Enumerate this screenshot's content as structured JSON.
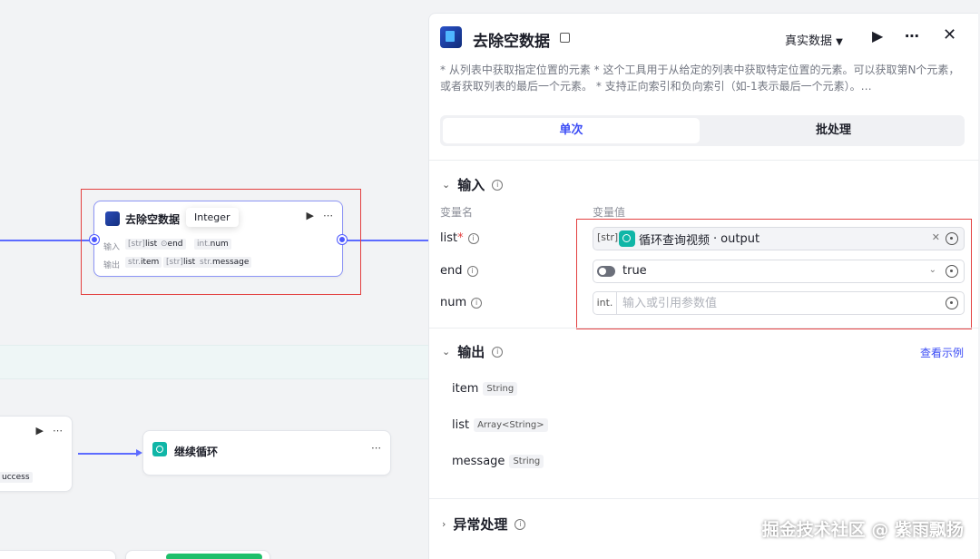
{
  "canvas": {
    "selected_node": {
      "title": "去除空数据",
      "tooltip": "Integer",
      "input_label": "输入",
      "output_label": "输出",
      "inputs": [
        {
          "type": "[str]",
          "name": "list"
        },
        {
          "type": "⊙",
          "name": "end"
        },
        {
          "type": "int.",
          "name": "num"
        }
      ],
      "outputs": [
        {
          "type": "str.",
          "name": "item"
        },
        {
          "type": "[str]",
          "name": "list"
        },
        {
          "type": "str.",
          "name": "message"
        }
      ]
    },
    "continue_node": {
      "title": "继续循环"
    },
    "partial_node": {
      "output_text": "uccess"
    }
  },
  "panel": {
    "title": "去除空数据",
    "mode": "真实数据",
    "description": "* 从列表中获取指定位置的元素 * 这个工具用于从给定的列表中获取特定位置的元素。可以获取第N个元素，或者获取列表的最后一个元素。 * 支持正向索引和负向索引（如-1表示最后一个元素）。…",
    "tabs": {
      "single": "单次",
      "batch": "批处理"
    },
    "input_section": {
      "title": "输入",
      "col_name": "变量名",
      "col_value": "变量值",
      "rows": [
        {
          "name": "list",
          "required": "*",
          "type": "[str]",
          "ref_node": "循环查询视频",
          "ref_sep": " · ",
          "ref_field": "output"
        },
        {
          "name": "end",
          "value": "true"
        },
        {
          "name": "num",
          "type": "int.",
          "placeholder": "输入或引用参数值"
        }
      ]
    },
    "output_section": {
      "title": "输出",
      "example_link": "查看示例",
      "rows": [
        {
          "name": "item",
          "type": "String"
        },
        {
          "name": "list",
          "type": "Array<String>"
        },
        {
          "name": "message",
          "type": "String"
        }
      ]
    },
    "exception_section": {
      "title": "异常处理"
    }
  },
  "watermark": "掘金技术社区 @ 紫雨飘扬",
  "colors": {
    "accent": "#3b4cf5",
    "edge": "#5d6bff",
    "highlight": "#e34040",
    "loop_icon": "#10b6a7"
  }
}
